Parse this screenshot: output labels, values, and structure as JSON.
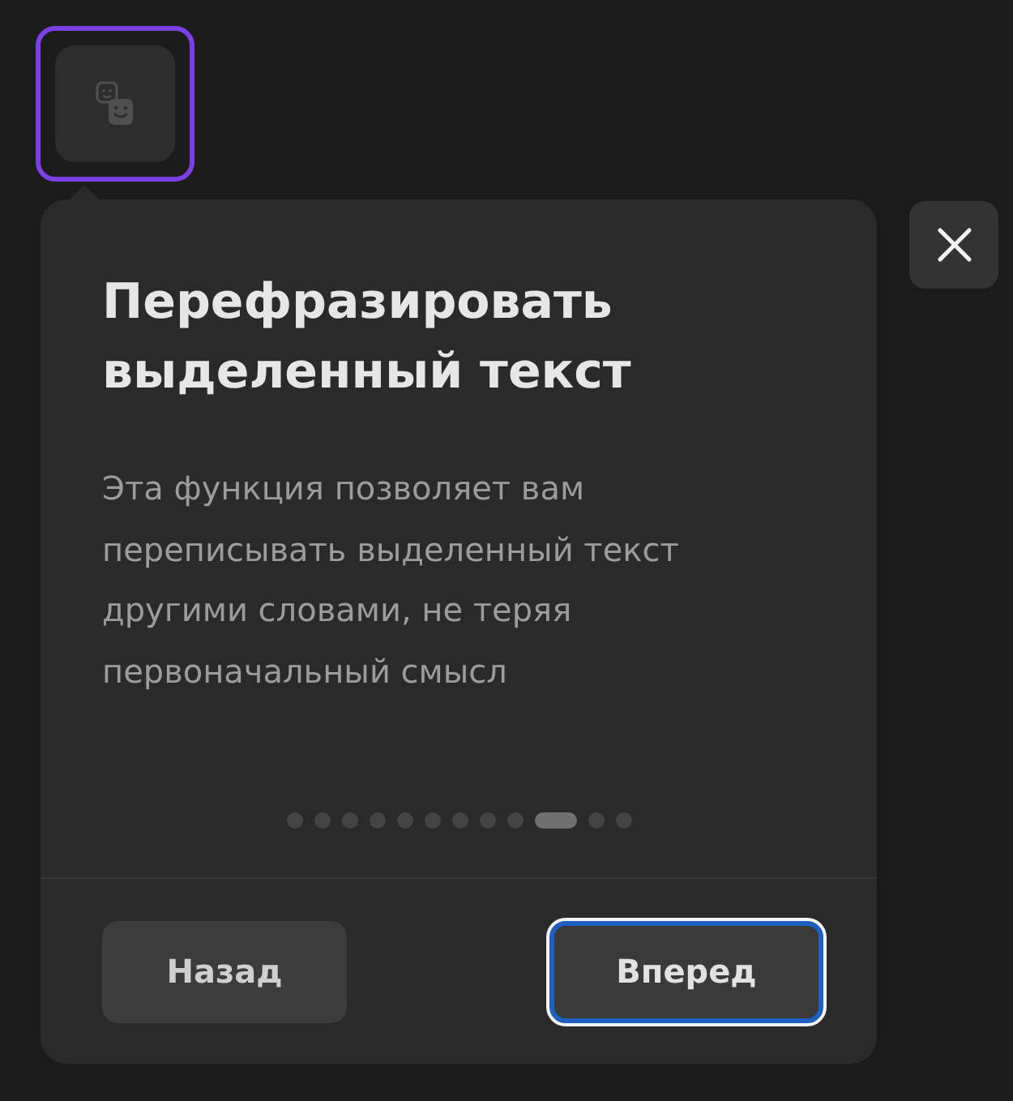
{
  "tool_button": {
    "highlighted": true
  },
  "popover": {
    "title": "Перефразировать выделенный текст",
    "description": "Эта функция позволяет вам переписывать выделенный текст другими словами, не теряя первоначальный смысл",
    "pager": [
      {
        "selected": false
      },
      {
        "selected": false
      },
      {
        "selected": false
      },
      {
        "selected": false
      },
      {
        "selected": false
      },
      {
        "selected": false
      },
      {
        "selected": false
      },
      {
        "selected": false
      },
      {
        "selected": false
      },
      {
        "selected": true
      },
      {
        "selected": false
      },
      {
        "selected": false
      }
    ],
    "buttons": [
      {
        "label": "Назад",
        "focused": false
      },
      {
        "label": "Вперед",
        "focused": true
      }
    ]
  }
}
